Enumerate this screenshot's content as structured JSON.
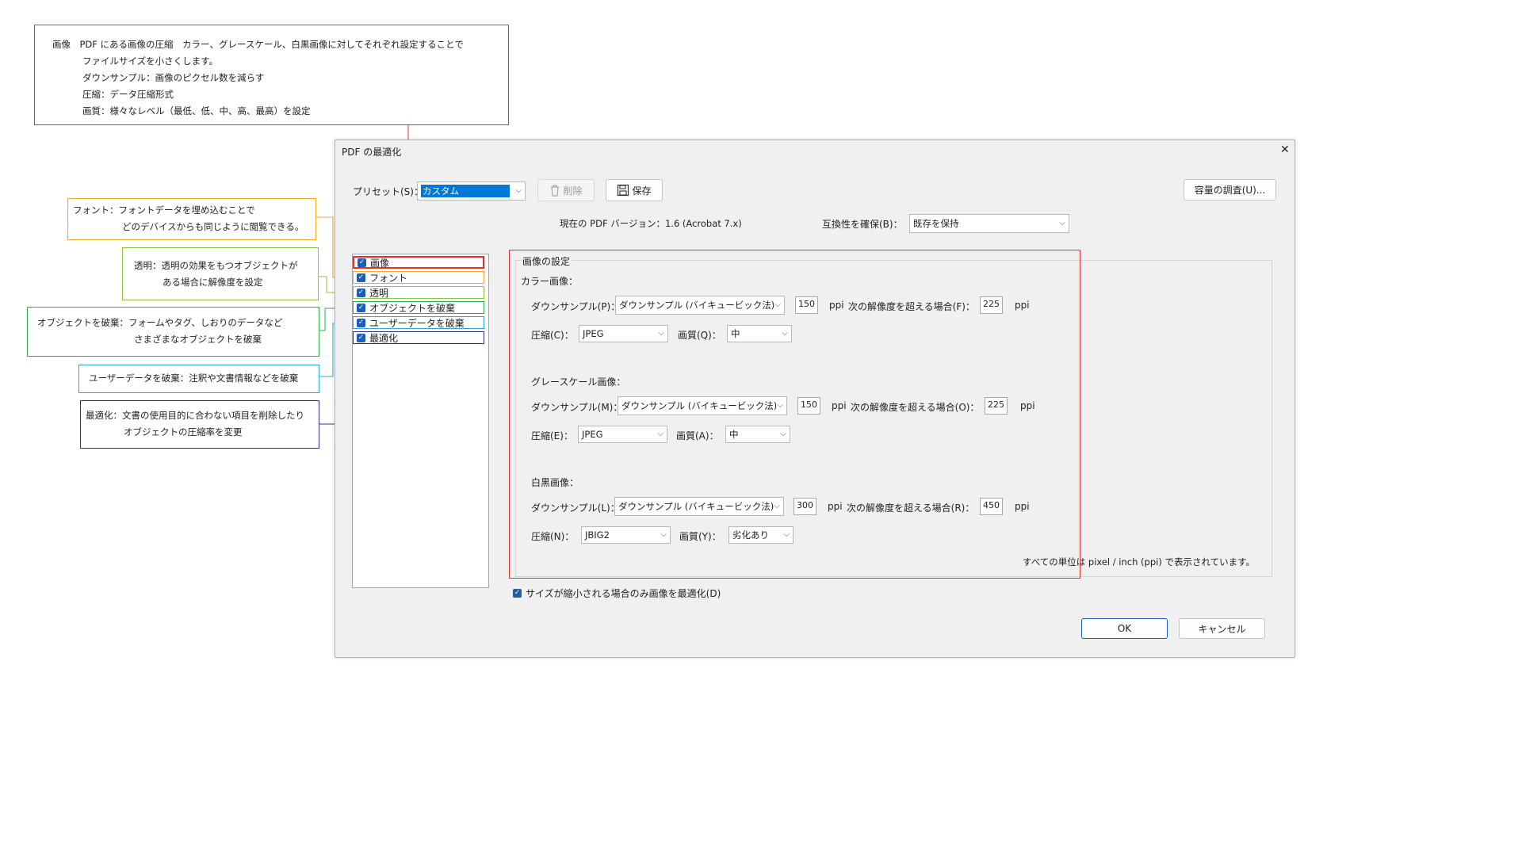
{
  "annotations": {
    "image": {
      "lines": [
        "画像　PDF にある画像の圧縮　カラー、グレースケール、白黒画像に対してそれぞれ設定することで",
        "ファイルサイズを小さくします。",
        "ダウンサンプル：画像のピクセル数を減らす",
        "圧縮：データ圧縮形式",
        "画質：様々なレベル（最低、低、中、高、最高）を設定"
      ]
    },
    "font": {
      "lines": [
        "フォント：フォントデータを埋め込むことで",
        "どのデバイスからも同じように閲覧できる。"
      ]
    },
    "transparency": {
      "lines": [
        "透明：透明の効果をもつオブジェクトが",
        "ある場合に解像度を設定"
      ]
    },
    "discard_objects": {
      "lines": [
        "オブジェクトを破棄：フォームやタグ、しおりのデータなど",
        "さまざまなオブジェクトを破棄"
      ]
    },
    "discard_user_data": {
      "lines": [
        "ユーザーデータを破棄：注釈や文書情報などを破棄"
      ]
    },
    "clean_up": {
      "lines": [
        "最適化：文書の使用目的に合わない項目を削除したり",
        "オブジェクトの圧縮率を変更"
      ]
    }
  },
  "dialog": {
    "title": "PDF の最適化",
    "close_glyph": "✕",
    "preset_label": "プリセット(S)：",
    "preset_value": "カスタム",
    "delete_label": "削除",
    "save_label": "保存",
    "audit_label": "容量の調査(U)...",
    "pdf_version_text": "現在の PDF バージョン：1.6 (Acrobat 7.x)",
    "compat_label": "互換性を確保(B)：",
    "compat_value": "既存を保持",
    "categories": [
      {
        "label": "画像",
        "checked": true
      },
      {
        "label": "フォント",
        "checked": true
      },
      {
        "label": "透明",
        "checked": true
      },
      {
        "label": "オブジェクトを破棄",
        "checked": true
      },
      {
        "label": "ユーザーデータを破棄",
        "checked": true
      },
      {
        "label": "最適化",
        "checked": true
      }
    ],
    "image_settings": {
      "group_title": "画像の設定",
      "color": {
        "title": "カラー画像：",
        "downsample_label": "ダウンサンプル(P)：",
        "downsample_value": "ダウンサンプル (バイキュービック法)",
        "ppi_value": "150",
        "ppi_unit": "ppi",
        "above_label": "次の解像度を超える場合(F)：",
        "above_value": "225",
        "above_unit": "ppi",
        "compression_label": "圧縮(C)：",
        "compression_value": "JPEG",
        "quality_label": "画質(Q)：",
        "quality_value": "中"
      },
      "gray": {
        "title": "グレースケール画像：",
        "downsample_label": "ダウンサンプル(M)：",
        "downsample_value": "ダウンサンプル (バイキュービック法)",
        "ppi_value": "150",
        "ppi_unit": "ppi",
        "above_label": "次の解像度を超える場合(O)：",
        "above_value": "225",
        "above_unit": "ppi",
        "compression_label": "圧縮(E)：",
        "compression_value": "JPEG",
        "quality_label": "画質(A)：",
        "quality_value": "中"
      },
      "mono": {
        "title": "白黒画像：",
        "downsample_label": "ダウンサンプル(L)：",
        "downsample_value": "ダウンサンプル (バイキュービック法)",
        "ppi_value": "300",
        "ppi_unit": "ppi",
        "above_label": "次の解像度を超える場合(R)：",
        "above_value": "450",
        "above_unit": "ppi",
        "compression_label": "圧縮(N)：",
        "compression_value": "JBIG2",
        "quality_label": "画質(Y)：",
        "quality_value": "劣化あり"
      },
      "units_note": "すべての単位は pixel / inch (ppi) で表示されています。"
    },
    "optimize_only_if_smaller": {
      "label": "サイズが縮小される場合のみ画像を最適化(D)",
      "checked": true
    },
    "ok_label": "OK",
    "cancel_label": "キャンセル"
  },
  "colors": {
    "image": "#e8302a",
    "font": "#f5a623",
    "transparency": "#8dc63f",
    "discard_objects": "#2fae4f",
    "discard_user_data": "#29a8e0",
    "clean_up": "#2e3192",
    "accent": "#1a5fb4",
    "preset_highlight": "#0078d7"
  }
}
